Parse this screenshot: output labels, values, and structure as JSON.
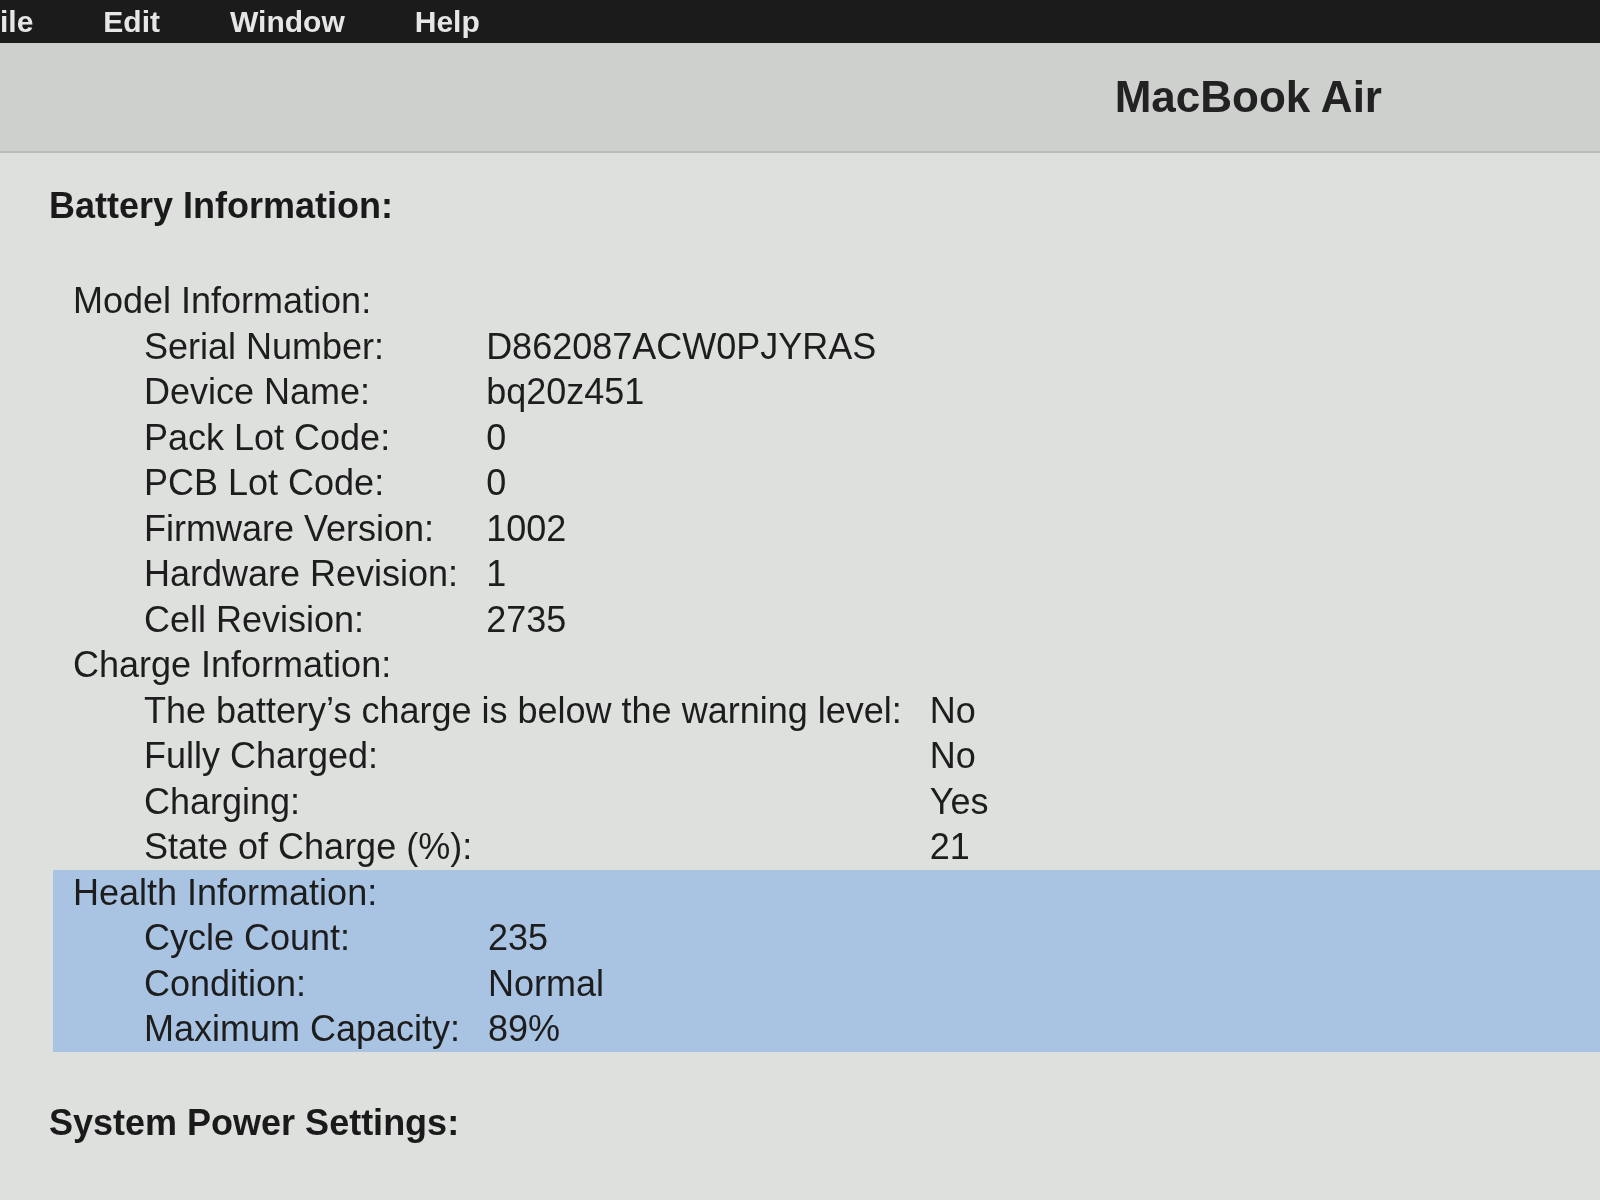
{
  "menu_bar": {
    "items": [
      "ile",
      "Edit",
      "Window",
      "Help"
    ]
  },
  "header": {
    "title": "MacBook Air"
  },
  "content": {
    "sections": [
      {
        "title": "Battery Information:",
        "groups": [
          {
            "title": "Model Information:",
            "selected": false,
            "rows": [
              {
                "label": "Serial Number:",
                "value": "D862087ACW0PJYRAS"
              },
              {
                "label": "Device Name:",
                "value": "bq20z451"
              },
              {
                "label": "Pack Lot Code:",
                "value": "0"
              },
              {
                "label": "PCB Lot Code:",
                "value": "0"
              },
              {
                "label": "Firmware Version:",
                "value": "1002"
              },
              {
                "label": "Hardware Revision:",
                "value": "1"
              },
              {
                "label": "Cell Revision:",
                "value": "2735"
              }
            ]
          },
          {
            "title": "Charge Information:",
            "selected": false,
            "rows": [
              {
                "label": "The battery’s charge is below the warning level:",
                "value": "No"
              },
              {
                "label": "Fully Charged:",
                "value": "No"
              },
              {
                "label": "Charging:",
                "value": "Yes"
              },
              {
                "label": "State of Charge (%):",
                "value": "21"
              }
            ]
          },
          {
            "title": "Health Information:",
            "selected": true,
            "rows": [
              {
                "label": "Cycle Count:",
                "value": "235"
              },
              {
                "label": "Condition:",
                "value": "Normal"
              },
              {
                "label": "Maximum Capacity:",
                "value": "89%"
              }
            ]
          }
        ]
      },
      {
        "title": "System Power Settings:"
      }
    ]
  }
}
